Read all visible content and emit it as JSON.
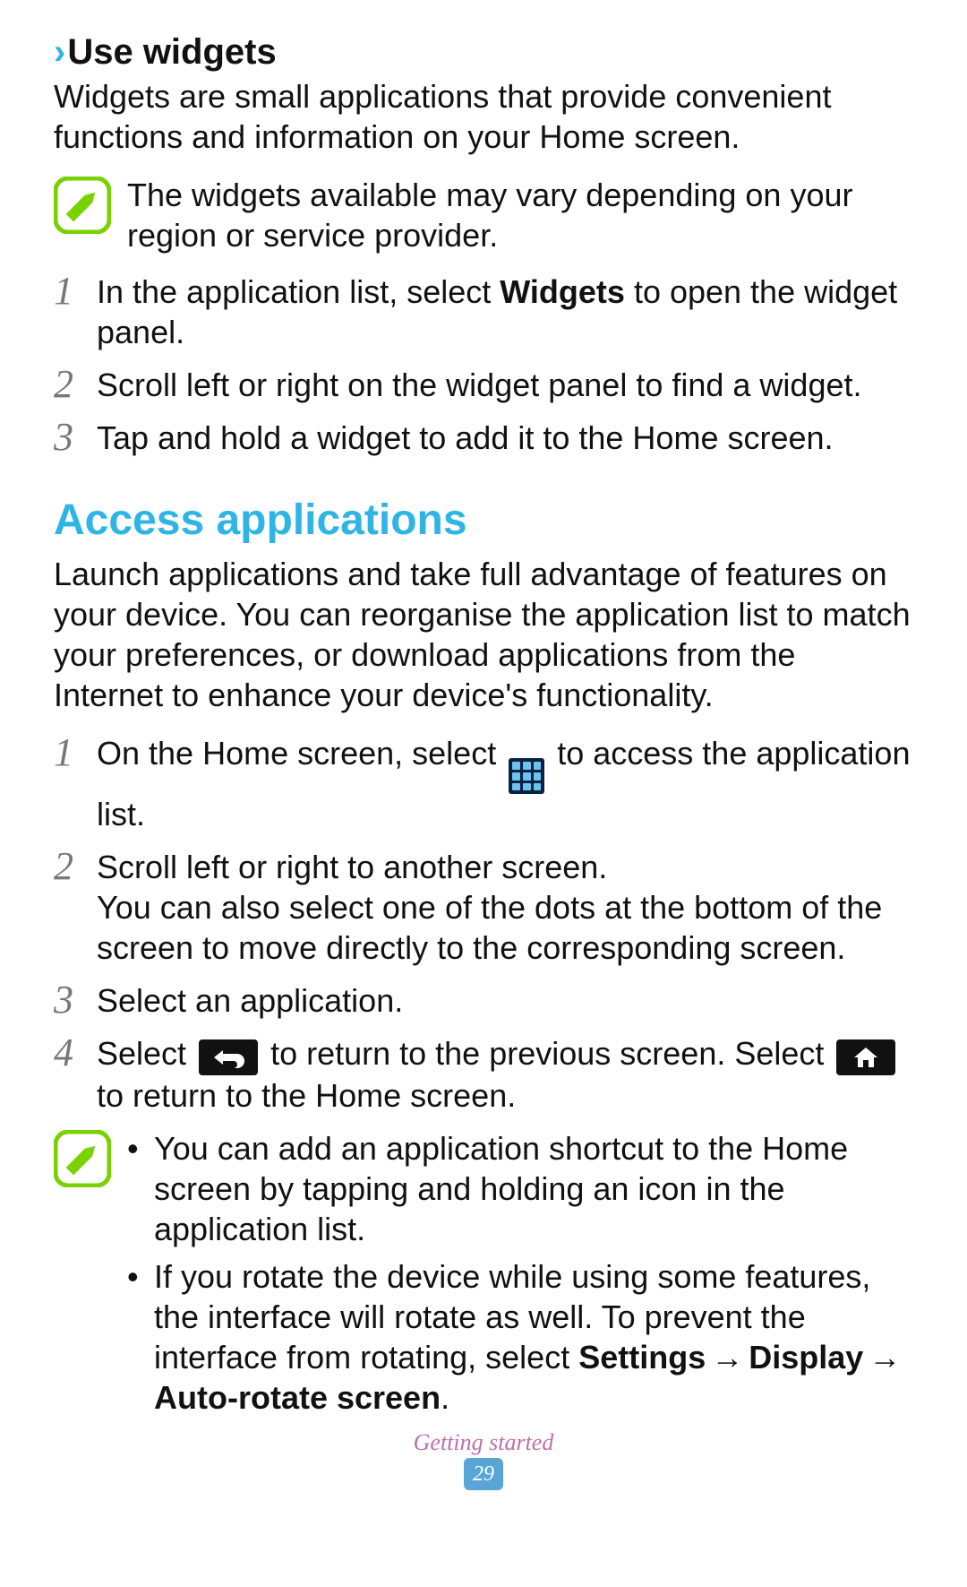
{
  "section1": {
    "chevron": "›",
    "title": "Use widgets",
    "intro": "Widgets are small applications that provide convenient functions and information on your Home screen.",
    "note": "The widgets available may vary depending on your region or service provider.",
    "steps": {
      "s1_pre": "In the application list, select ",
      "s1_bold": "Widgets",
      "s1_post": " to open the widget panel.",
      "s2": "Scroll left or right on the widget panel to find a widget.",
      "s3": "Tap and hold a widget to add it to the Home screen."
    }
  },
  "section2": {
    "title": "Access applications",
    "intro": "Launch applications and take full advantage of features on your device. You can reorganise the application list to match your preferences, or download applications from the Internet to enhance your device's functionality.",
    "steps": {
      "s1_pre": "On the Home screen, select ",
      "s1_post": " to access the application list.",
      "s2_line1": "Scroll left or right to another screen.",
      "s2_line2": "You can also select one of the dots at the bottom of the screen to move directly to the corresponding screen.",
      "s3": "Select an application.",
      "s4_pre": "Select ",
      "s4_mid": " to return to the previous screen. Select ",
      "s4_post": " to return to the Home screen."
    },
    "notes": {
      "b1": "You can add an application shortcut to the Home screen by tapping and holding an icon in the application list.",
      "b2_pre": "If you rotate the device while using some features, the interface will rotate as well. To prevent the interface from rotating, select ",
      "b2_bold1": "Settings",
      "b2_bold2": "Display",
      "b2_bold3": "Auto-rotate screen",
      "arrow": "→",
      "period": "."
    }
  },
  "nums": {
    "n1": "1",
    "n2": "2",
    "n3": "3",
    "n4": "4"
  },
  "bullet": "•",
  "footer": {
    "section": "Getting started",
    "page": "29"
  }
}
